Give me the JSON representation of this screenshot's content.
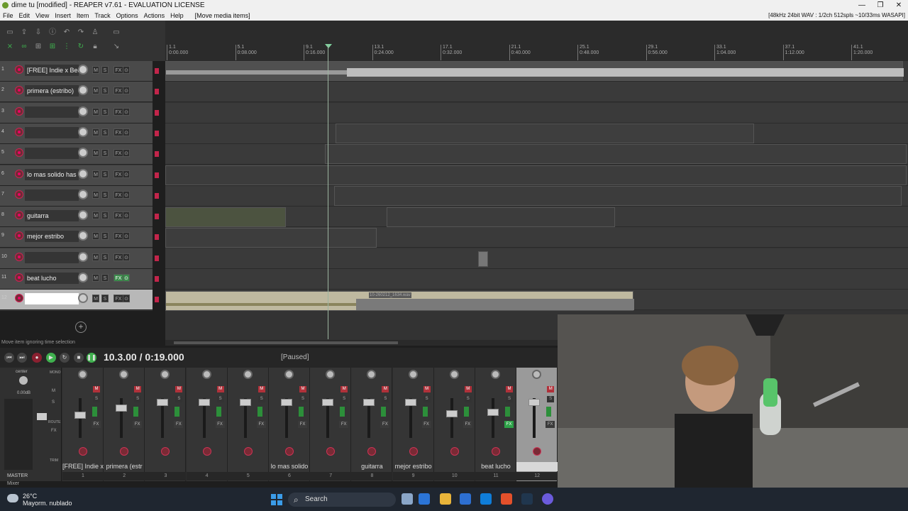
{
  "window": {
    "title": "dime tu [modified] - REAPER v7.61 - EVALUATION LICENSE",
    "controls": [
      "—",
      "❐",
      "✕"
    ]
  },
  "menu": {
    "items": [
      "File",
      "Edit",
      "View",
      "Insert",
      "Item",
      "Track",
      "Options",
      "Actions",
      "Help",
      "[Move media items]"
    ],
    "status": "[48kHz 24bit WAV : 1/2ch 512spls ~10/33ms WASAPI]"
  },
  "ruler": {
    "ticks": [
      {
        "bar": "1.1",
        "time": "0:00.000"
      },
      {
        "bar": "5.1",
        "time": "0:08.000"
      },
      {
        "bar": "9.1",
        "time": "0:16.000"
      },
      {
        "bar": "13.1",
        "time": "0:24.000"
      },
      {
        "bar": "17.1",
        "time": "0:32.000"
      },
      {
        "bar": "21.1",
        "time": "0:40.000"
      },
      {
        "bar": "25.1",
        "time": "0:48.000"
      },
      {
        "bar": "29.1",
        "time": "0:56.000"
      },
      {
        "bar": "33.1",
        "time": "1:04.000"
      },
      {
        "bar": "37.1",
        "time": "1:12.000"
      },
      {
        "bar": "41.1",
        "time": "1:20.000"
      }
    ]
  },
  "tracks": [
    {
      "num": "1",
      "name": "[FREE] Indie x Bec",
      "fx_on": false
    },
    {
      "num": "2",
      "name": "primera (estribo)",
      "fx_on": false
    },
    {
      "num": "3",
      "name": "",
      "fx_on": false
    },
    {
      "num": "4",
      "name": "",
      "fx_on": false
    },
    {
      "num": "5",
      "name": "",
      "fx_on": false
    },
    {
      "num": "6",
      "name": "lo mas solido has",
      "fx_on": false
    },
    {
      "num": "7",
      "name": "",
      "fx_on": false
    },
    {
      "num": "8",
      "name": "guitarra",
      "fx_on": false
    },
    {
      "num": "9",
      "name": "mejor estribo",
      "fx_on": false
    },
    {
      "num": "10",
      "name": "",
      "fx_on": false
    },
    {
      "num": "11",
      "name": "beat lucho",
      "fx_on": true
    },
    {
      "num": "12",
      "name": "",
      "fx_on": false
    }
  ],
  "track_buttons": {
    "mute": "M",
    "solo": "S",
    "fx": "FX"
  },
  "media_item_label": "10-260212_1634.wav",
  "status_message": "Move item ignoring time selection",
  "transport": {
    "time": "10.3.00 / 0:19.000",
    "state": "[Paused]"
  },
  "mixer": {
    "master_label": "MASTER",
    "master_pan": "center",
    "master_db": "0.00dB",
    "master_buttons": [
      "MONO",
      "M",
      "S",
      "ROUTE",
      "FX",
      "TRIM"
    ],
    "strips": [
      {
        "name": "[FREE] Indie x",
        "num": "1"
      },
      {
        "name": "primera (estr",
        "num": "2"
      },
      {
        "name": "",
        "num": "3"
      },
      {
        "name": "",
        "num": "4"
      },
      {
        "name": "",
        "num": "5"
      },
      {
        "name": "lo mas solido",
        "num": "6"
      },
      {
        "name": "",
        "num": "7"
      },
      {
        "name": "guitarra",
        "num": "8"
      },
      {
        "name": "mejor estribo",
        "num": "9"
      },
      {
        "name": "",
        "num": "10"
      },
      {
        "name": "beat lucho",
        "num": "11"
      },
      {
        "name": "",
        "num": "12"
      }
    ],
    "tab_label": "Mixer"
  },
  "taskbar": {
    "temp": "26°C",
    "weather": "Mayorm. nublado",
    "search_placeholder": "Search"
  },
  "colors": {
    "accent_green": "#3fb04e",
    "mute_red": "#b0313a",
    "record_red": "#c22255"
  }
}
